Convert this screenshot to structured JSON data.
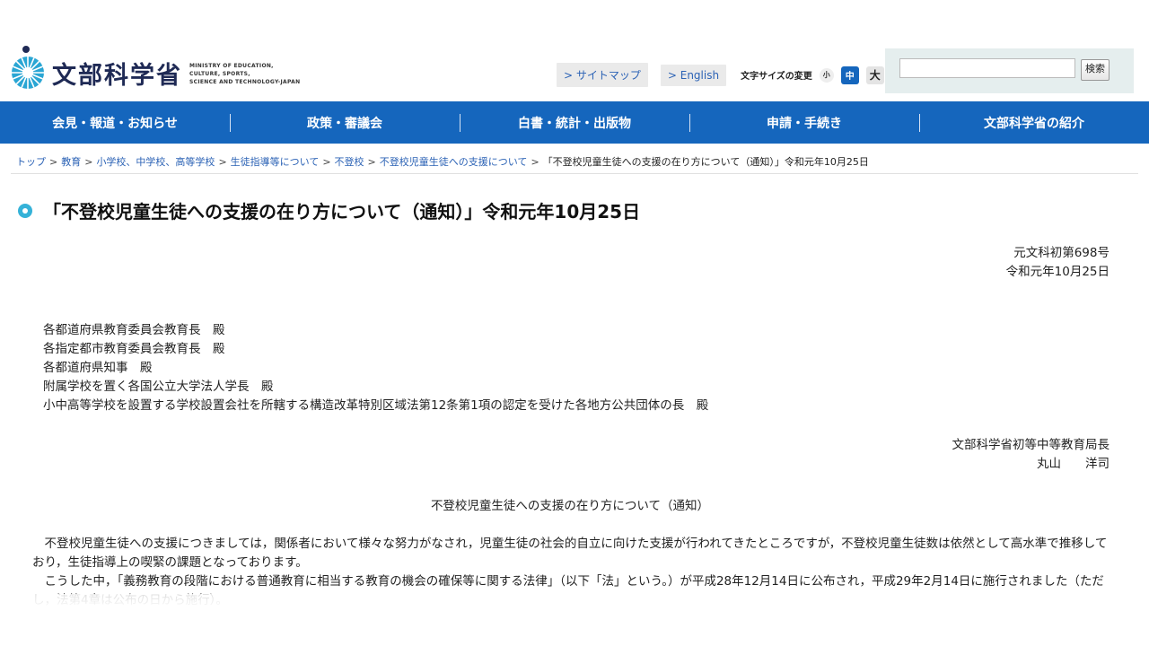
{
  "header": {
    "logo_jp": "文部科学省",
    "logo_en": [
      "MINISTRY OF EDUCATION,",
      "CULTURE, SPORTS,",
      "SCIENCE AND TECHNOLOGY-JAPAN"
    ],
    "links": [
      "> サイトマップ",
      "> English"
    ],
    "font_size": {
      "label": "文字サイズの変更",
      "small": "小",
      "medium": "中",
      "large": "大"
    },
    "search": {
      "button": "検索",
      "value": ""
    }
  },
  "nav": {
    "items": [
      "会見・報道・お知らせ",
      "政策・審議会",
      "白書・統計・出版物",
      "申請・手続き",
      "文部科学省の紹介"
    ]
  },
  "breadcrumb": {
    "links": [
      "トップ",
      "教育",
      "小学校、中学校、高等学校",
      "生徒指導等について",
      "不登校",
      "不登校児童生徒への支援について"
    ],
    "current": "「不登校児童生徒への支援の在り方について（通知）」令和元年10月25日",
    "separator": ">"
  },
  "main": {
    "title": "「不登校児童生徒への支援の在り方について（通知）」令和元年10月25日",
    "doc_number": "元文科初第698号",
    "doc_date": "令和元年10月25日",
    "recipients": [
      "各都道府県教育委員会教育長　殿",
      "各指定都市教育委員会教育長　殿",
      "各都道府県知事　殿",
      "附属学校を置く各国公立大学法人学長　殿",
      "小中高等学校を設置する学校設置会社を所轄する構造改革特別区域法第12条第1項の認定を受けた各地方公共団体の長　殿"
    ],
    "sender_title": "文部科学省初等中等教育局長",
    "sender_name": "丸山　　洋司",
    "subject": "不登校児童生徒への支援の在り方について（通知）",
    "paragraphs": [
      "不登校児童生徒への支援につきましては，関係者において様々な努力がなされ，児童生徒の社会的自立に向けた支援が行われてきたところですが，不登校児童生徒数は依然として高水準で推移しており，生徒指導上の喫緊の課題となっております。",
      "こうした中，「義務教育の段階における普通教育に相当する教育の機会の確保等に関する法律」（以下「法」という。）が平成28年12月14日に公布され，平成29年2月14日に施行されました（ただし，法第4章は公布の日から施行）。"
    ]
  },
  "colors": {
    "nav_bg": "#1566bd",
    "link": "#2b62b5",
    "title_bullet": "#35b2d8"
  }
}
